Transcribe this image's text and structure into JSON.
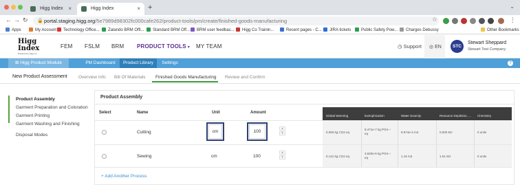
{
  "browser": {
    "tabs": [
      {
        "title": "Higg Index",
        "active": false
      },
      {
        "title": "Higg Index",
        "active": true
      }
    ],
    "new_tab": "+",
    "close": "×",
    "url_host": "portal.staging.higg.org",
    "url_path": "/5e7989d98302fc000cafe262/product-tools/pm/create/finished-goods-manufacturing",
    "bookmarks": [
      "Apps",
      "My Account",
      "Technology Office...",
      "Zalando BRM Offi...",
      "Standard BRM Off...",
      "BRM user feedbac...",
      "Higg Co Trainin...",
      "Recent pages - C...",
      "JIRA tickets",
      "Public Safety Pow...",
      "Charges Debussy",
      "Other Bookmarks"
    ]
  },
  "app": {
    "logo": {
      "line1": "Higg",
      "line2": "Index",
      "tagline": "Powered by Higg Co"
    },
    "nav": [
      "FEM",
      "FSLM",
      "BRM",
      "PRODUCT TOOLS",
      "MY TEAM"
    ],
    "nav_active": "PRODUCT TOOLS",
    "support": "Support",
    "language": "EN",
    "user": {
      "initials": "STC",
      "name": "Stewart Sheppard",
      "company": "Stewart Test Company"
    }
  },
  "module_bar": {
    "module": "Higg Product Module",
    "items": [
      "PM Dashboard",
      "Product Library",
      "Settings"
    ],
    "active": "Product Library",
    "help": "?"
  },
  "steps": {
    "title": "New Product Assessment",
    "items": [
      "Overview Info",
      "Bill Of Materials",
      "Finished Goods Manufacturing",
      "Review and Confirm"
    ],
    "active": "Finished Goods Manufacturing"
  },
  "sidebar": {
    "items": [
      "Product Assembly",
      "Garment Preparation and Coloration",
      "Garment Printing",
      "Garment Washing and Finishing",
      "Disposal Modes"
    ],
    "active": "Product Assembly"
  },
  "panel": {
    "title": "Product Assembly",
    "columns": {
      "select": "Select",
      "name": "Name",
      "unit": "Unit",
      "amount": "Amount"
    },
    "impact_columns": [
      "Global Warming",
      "Eutrophication",
      "Water Scarcity",
      "Resource Depletion, ...",
      "Chemistry"
    ],
    "rows": [
      {
        "name": "Cutting",
        "unit": "cm",
        "amount": "100",
        "impacts": [
          "0.093 kg CO2 eq",
          "8.471e-7 kg PO4--- eq",
          "8.974e-4 m3",
          "0.000 MJ",
          "0 units"
        ]
      },
      {
        "name": "Sewing",
        "unit": "cm",
        "amount": "100",
        "impacts": [
          "0.141 kg CO2 eq",
          "3.620e-5 kg PO4--- eq",
          "1.15 m3",
          "1.51 MJ",
          "0 units"
        ]
      }
    ],
    "add_process": "+ Add Another Process"
  },
  "colors": {
    "module_bar": "#4fa0d8",
    "active_nav": "#5b2f8f",
    "highlight_border": "#2b3f74",
    "step_underline": "#3c9a3c",
    "link": "#3d8bd0"
  }
}
